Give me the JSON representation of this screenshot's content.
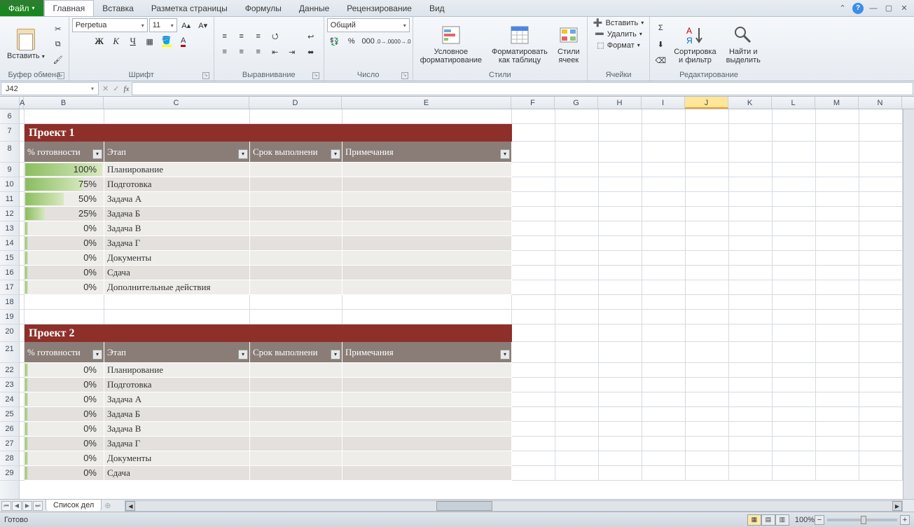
{
  "tabs": {
    "file": "Файл",
    "items": [
      "Главная",
      "Вставка",
      "Разметка страницы",
      "Формулы",
      "Данные",
      "Рецензирование",
      "Вид"
    ],
    "active": 0
  },
  "ribbon": {
    "clipboard": {
      "paste": "Вставить",
      "label": "Буфер обмена"
    },
    "font": {
      "name": "Perpetua",
      "size": "11",
      "label": "Шрифт"
    },
    "alignment": {
      "label": "Выравнивание"
    },
    "number": {
      "format": "Общий",
      "label": "Число"
    },
    "styles": {
      "conditional": "Условное\nформатирование",
      "astable": "Форматировать\nкак таблицу",
      "cellstyles": "Стили\nячеек",
      "label": "Стили"
    },
    "cells": {
      "insert": "Вставить",
      "delete": "Удалить",
      "format": "Формат",
      "label": "Ячейки"
    },
    "editing": {
      "sort": "Сортировка\nи фильтр",
      "find": "Найти и\nвыделить",
      "label": "Редактирование"
    }
  },
  "namebox": "J42",
  "columns": [
    "A",
    "B",
    "C",
    "D",
    "E",
    "F",
    "G",
    "H",
    "I",
    "J",
    "K",
    "L",
    "M",
    "N"
  ],
  "row_start": 6,
  "row_end": 29,
  "project1": {
    "title": "Проект 1",
    "headers": [
      "% готовности",
      "Этап",
      "Срок выполнени",
      "Примечания"
    ],
    "rows": [
      {
        "pct": 100,
        "stage": "Планирование"
      },
      {
        "pct": 75,
        "stage": "Подготовка"
      },
      {
        "pct": 50,
        "stage": "Задача А"
      },
      {
        "pct": 25,
        "stage": "Задача Б"
      },
      {
        "pct": 0,
        "stage": "Задача В"
      },
      {
        "pct": 0,
        "stage": "Задача Г"
      },
      {
        "pct": 0,
        "stage": "Документы"
      },
      {
        "pct": 0,
        "stage": "Сдача"
      },
      {
        "pct": 0,
        "stage": "Дополнительные действия"
      }
    ]
  },
  "project2": {
    "title": "Проект 2",
    "headers": [
      "% готовности",
      "Этап",
      "Срок выполнени",
      "Примечания"
    ],
    "rows": [
      {
        "pct": 0,
        "stage": "Планирование"
      },
      {
        "pct": 0,
        "stage": "Подготовка"
      },
      {
        "pct": 0,
        "stage": "Задача А"
      },
      {
        "pct": 0,
        "stage": "Задача Б"
      },
      {
        "pct": 0,
        "stage": "Задача В"
      },
      {
        "pct": 0,
        "stage": "Задача Г"
      },
      {
        "pct": 0,
        "stage": "Документы"
      },
      {
        "pct": 0,
        "stage": "Сдача"
      }
    ]
  },
  "sheet_tab": "Список дел",
  "status": "Готово",
  "zoom": "100%"
}
